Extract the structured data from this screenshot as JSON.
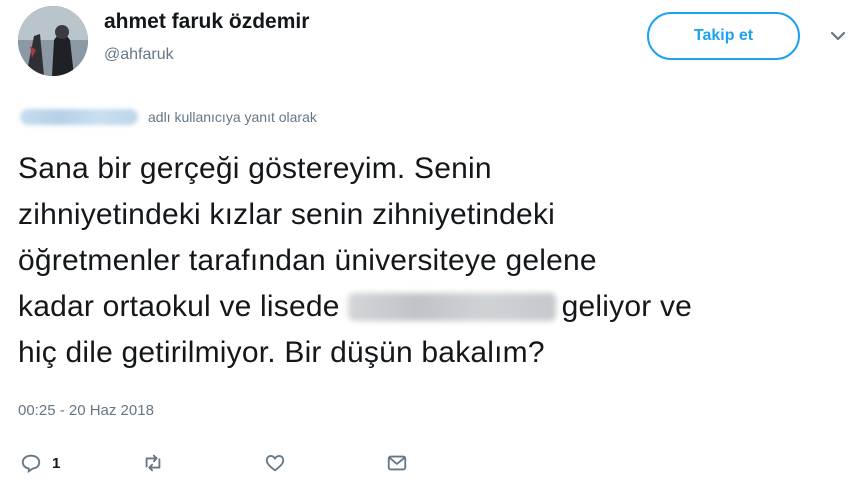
{
  "header": {
    "name": "ahmet faruk özdemir",
    "handle": "@ahfaruk",
    "follow_label": "Takip et"
  },
  "reply_context": {
    "text": "adlı kullanıcıya yanıt olarak"
  },
  "tweet": {
    "lines": [
      "Sana bir gerçeği göstereyim. Senin",
      "zihniyetindeki kızlar senin zihniyetindeki",
      "öğretmenler tarafından üniversiteye gelene"
    ],
    "line4_before": "kadar ortaokul ve lisede",
    "line4_after": "geliyor ve",
    "line5": "hiç dile getirilmiyor. Bir düşün bakalım?"
  },
  "timestamp": "00:25 - 20 Haz 2018",
  "actions": {
    "reply_count": "1",
    "icons": [
      "reply-icon",
      "retweet-icon",
      "like-icon",
      "message-icon"
    ]
  },
  "colors": {
    "accent": "#1da1f2",
    "secondary_text": "#657786",
    "primary_text": "#14171a"
  }
}
